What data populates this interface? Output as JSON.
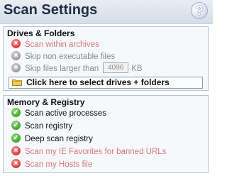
{
  "header": {
    "title": "Scan Settings",
    "help_glyph": "?"
  },
  "drives": {
    "title": "Drives & Folders",
    "options": [
      {
        "label": "Scan within archives",
        "state": "off"
      },
      {
        "label": "Skip non executable files",
        "state": "disabled"
      },
      {
        "label": "Skip files larger than",
        "state": "disabled",
        "value": "4096",
        "unit": "KB"
      }
    ],
    "select_button": "Click here to select drives + folders"
  },
  "memory": {
    "title": "Memory & Registry",
    "options": [
      {
        "label": "Scan active processes",
        "state": "on"
      },
      {
        "label": "Scan registry",
        "state": "on"
      },
      {
        "label": "Deep scan registry",
        "state": "on"
      },
      {
        "label": "Scan my IE Favorites for banned URLs",
        "state": "off"
      },
      {
        "label": "Scan my Hosts file",
        "state": "off"
      }
    ]
  },
  "icons": {
    "off": "red-x-icon",
    "disabled": "gray-x-icon",
    "on": "green-check-icon"
  },
  "colors": {
    "header_text": "#1f2e45",
    "off_text": "#d77a7a",
    "disabled_text": "#8b8b8b"
  }
}
